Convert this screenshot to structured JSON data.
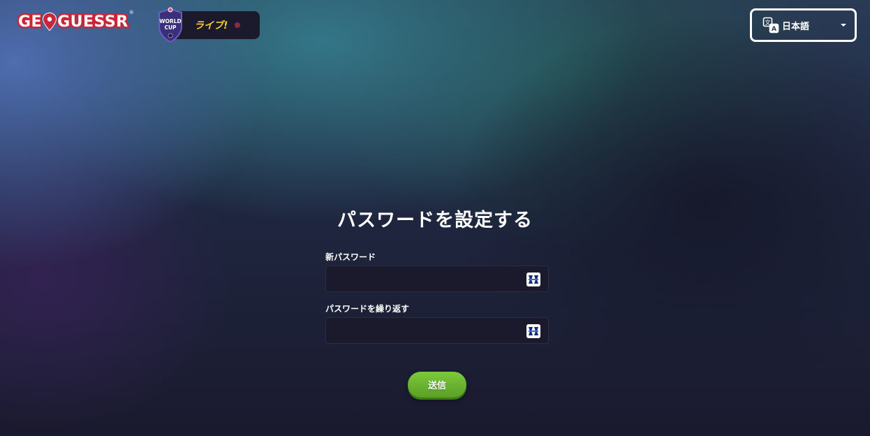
{
  "header": {
    "logo": {
      "prefix": "GE",
      "suffix": "GUESSR",
      "registered": "®",
      "pin_icon": "location-pin-icon"
    },
    "world_cup_badge": {
      "shield_text_line1": "WORLD",
      "shield_text_line2": "CUP",
      "live_label": "ライブ!",
      "live_indicator_color": "#8a2a48"
    },
    "language": {
      "icon": "translate-icon",
      "selected": "日本語",
      "caret_icon": "chevron-down-icon"
    }
  },
  "form": {
    "title": "パスワードを設定する",
    "new_password": {
      "label": "新パスワード",
      "value": "",
      "icon": "password-manager-icon"
    },
    "repeat_password": {
      "label": "パスワードを繰り返す",
      "value": "",
      "icon": "password-manager-icon"
    },
    "submit_label": "送信"
  },
  "colors": {
    "accent_green": "#6cb82f",
    "brand_red": "#c9263a",
    "live_yellow": "#f7c932",
    "field_bg": "#1a1a2c"
  }
}
